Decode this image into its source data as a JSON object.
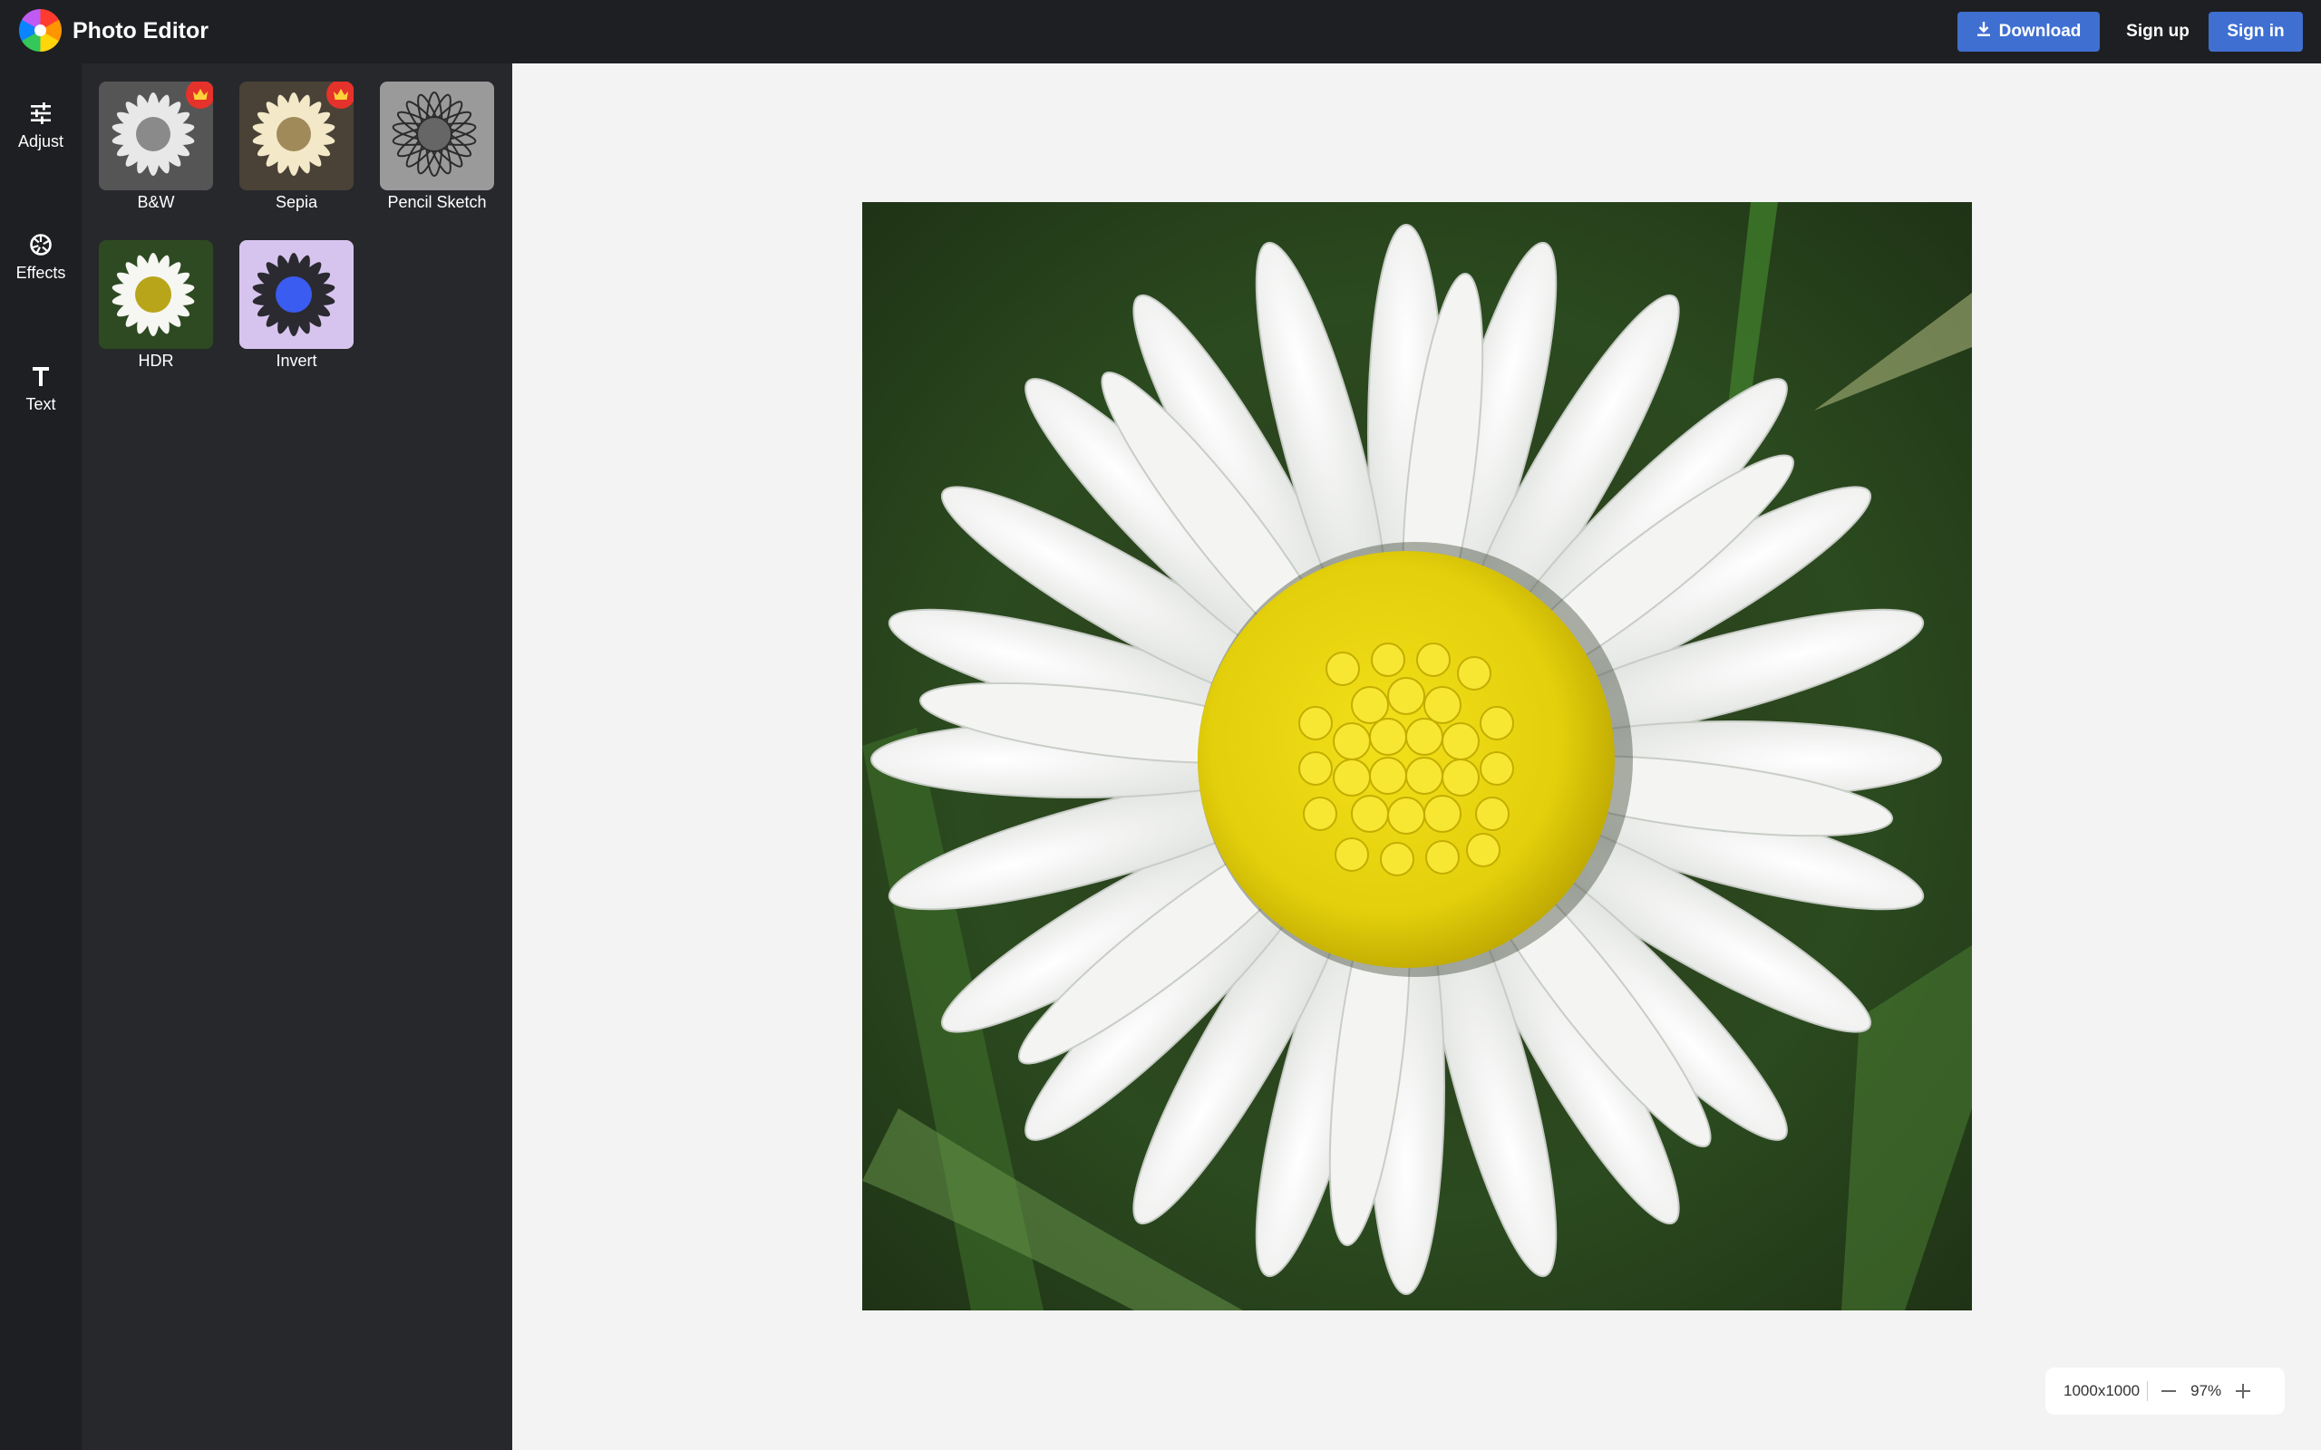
{
  "app": {
    "title": "Photo Editor",
    "logo_icon": "color-wheel-logo"
  },
  "header": {
    "download_label": "Download",
    "signup_label": "Sign up",
    "signin_label": "Sign in",
    "accent_color": "#3f6fd1"
  },
  "rail": {
    "items": [
      {
        "label": "Adjust",
        "icon": "sliders-icon"
      },
      {
        "label": "Effects",
        "icon": "aperture-icon"
      },
      {
        "label": "Text",
        "icon": "text-icon"
      }
    ]
  },
  "effects": {
    "items": [
      {
        "label": "B&W",
        "premium": true
      },
      {
        "label": "Sepia",
        "premium": true
      },
      {
        "label": "Pencil Sketch",
        "premium": false
      },
      {
        "label": "HDR",
        "premium": false
      },
      {
        "label": "Invert",
        "premium": false
      }
    ]
  },
  "canvas": {
    "image_subject": "white daisy with yellow center"
  },
  "zoom": {
    "size": "1000x1000",
    "level": "97%"
  }
}
